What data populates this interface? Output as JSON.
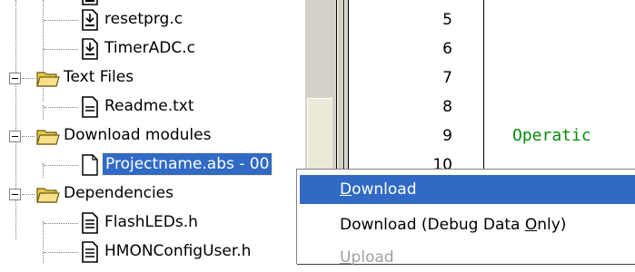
{
  "tree": {
    "items": [
      {
        "label": "",
        "icon": "source-file-icon",
        "type": "file"
      },
      {
        "label": "resetprg.c",
        "icon": "source-file-icon",
        "type": "file"
      },
      {
        "label": "TimerADC.c",
        "icon": "source-file-icon",
        "type": "file"
      },
      {
        "label": "Text Files",
        "icon": "folder-open-icon",
        "type": "folder",
        "expanded": true
      },
      {
        "label": "Readme.txt",
        "icon": "text-file-icon",
        "type": "file"
      },
      {
        "label": "Download modules",
        "icon": "folder-open-icon",
        "type": "folder",
        "expanded": true
      },
      {
        "label": "Projectname.abs - 00",
        "icon": "blank-file-icon",
        "type": "file",
        "selected": true
      },
      {
        "label": "Dependencies",
        "icon": "folder-open-icon",
        "type": "folder",
        "expanded": true
      },
      {
        "label": "FlashLEDs.h",
        "icon": "header-file-icon",
        "type": "file"
      },
      {
        "label": "HMONConfigUser.h",
        "icon": "header-file-icon",
        "type": "file"
      }
    ]
  },
  "editor": {
    "line_numbers": [
      "",
      "5",
      "6",
      "7",
      "8",
      "9",
      "10"
    ],
    "code_text": "Operatic"
  },
  "context_menu": {
    "items": [
      {
        "label_pre": "",
        "label_key": "D",
        "label_post": "ownload",
        "highlighted": true,
        "disabled": false
      },
      {
        "label_pre": "Download (Debug Data ",
        "label_key": "O",
        "label_post": "nly)",
        "highlighted": false,
        "disabled": false
      },
      {
        "label_pre": "",
        "label_key": "U",
        "label_post": "pload",
        "highlighted": false,
        "disabled": true
      }
    ]
  },
  "colors": {
    "selection": "#316ac5",
    "code_comment": "#0a8a0a",
    "gutter": "#d4d0c8"
  }
}
